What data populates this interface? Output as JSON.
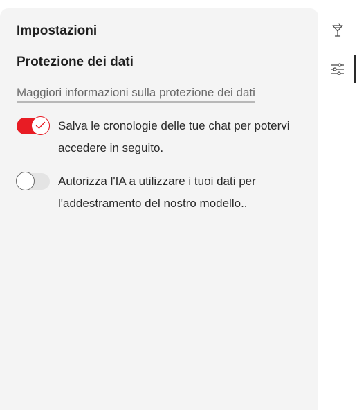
{
  "settings": {
    "title": "Impostazioni",
    "section_title": "Protezione dei dati",
    "info_link": "Maggiori informazioni sulla protezione dei dati",
    "options": [
      {
        "label": "Salva le cronologie delle tue chat per potervi accedere in seguito.",
        "enabled": true
      },
      {
        "label": "Autorizza l'IA a utilizzare i tuoi dati per l'addestramento del nostro modello..",
        "enabled": false
      }
    ]
  },
  "sidebar": {
    "icons": [
      "cocktail-icon",
      "sliders-icon"
    ],
    "active": "sliders-icon"
  },
  "colors": {
    "accent": "#e81c24",
    "panel_bg": "#f4f4f4",
    "text": "#1f1f1f",
    "muted": "#6a6a6a"
  }
}
